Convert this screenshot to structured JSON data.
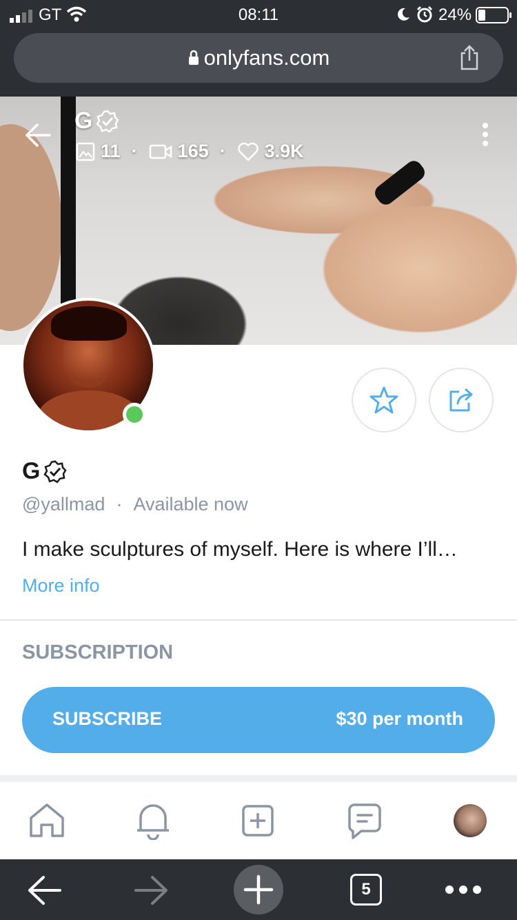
{
  "status_bar": {
    "carrier": "GT",
    "time": "08:11",
    "battery": "24%"
  },
  "browser": {
    "url": "onlyfans.com",
    "tabs_count": "5"
  },
  "profile": {
    "name": "G",
    "stats": {
      "photos": "11",
      "videos": "165",
      "likes": "3.9K"
    },
    "handle": "@yallmad",
    "separator": "·",
    "availability": "Available now",
    "bio": "I make sculptures of myself. Here is where I’ll…",
    "more_info": "More info"
  },
  "subscription": {
    "heading": "SUBSCRIPTION",
    "button_label": "SUBSCRIBE",
    "price": "$30 per month"
  },
  "colors": {
    "accent": "#52ade9",
    "online": "#5bc95a",
    "muted": "#8a96a3"
  },
  "icons": [
    "back-arrow-icon",
    "verified-icon",
    "image-icon",
    "video-icon",
    "heart-icon",
    "more-vertical-icon",
    "star-icon",
    "share-icon",
    "home-icon",
    "bell-icon",
    "add-icon",
    "messages-icon",
    "lock-icon",
    "upload-icon"
  ]
}
